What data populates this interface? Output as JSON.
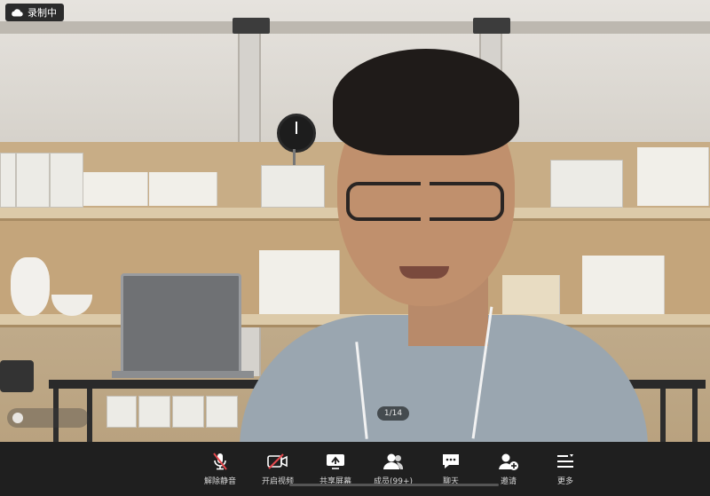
{
  "recording": {
    "label": "录制中"
  },
  "video": {
    "page_indicator": "1/14"
  },
  "toolbar": {
    "items": [
      {
        "id": "unmute",
        "label": "解除静音",
        "icon": "mic-muted-icon"
      },
      {
        "id": "start-video",
        "label": "开启视频",
        "icon": "video-off-icon"
      },
      {
        "id": "share-screen",
        "label": "共享屏幕",
        "icon": "share-screen-icon"
      },
      {
        "id": "members",
        "label": "成员(99+)",
        "icon": "members-icon"
      },
      {
        "id": "chat",
        "label": "聊天",
        "icon": "chat-icon"
      },
      {
        "id": "invite",
        "label": "邀请",
        "icon": "invite-icon"
      },
      {
        "id": "more",
        "label": "更多",
        "icon": "more-icon"
      }
    ]
  },
  "colors": {
    "muted_red": "#e5484d",
    "toolbar_bg": "#1f1f1f",
    "icon": "#ffffff"
  }
}
